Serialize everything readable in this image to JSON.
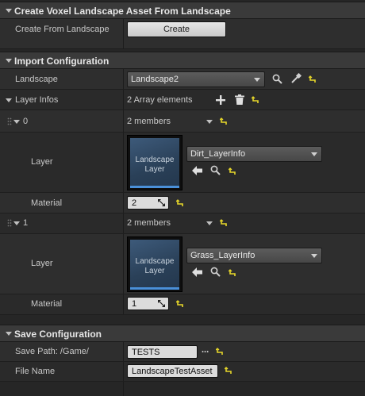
{
  "sections": {
    "create": {
      "title": "Create Voxel Landscape Asset From Landscape"
    },
    "import": {
      "title": "Import Configuration"
    },
    "save": {
      "title": "Save Configuration"
    }
  },
  "create_row": {
    "label": "Create From Landscape",
    "button_label": "Create"
  },
  "landscape_row": {
    "label": "Landscape",
    "value": "Landscape2"
  },
  "layer_infos": {
    "label": "Layer Infos",
    "count_text": "2 Array elements"
  },
  "elements": [
    {
      "index": "0",
      "members_text": "2 members",
      "layer_label": "Layer",
      "thumbnail_text": "Landscape Layer",
      "layer_value": "Dirt_LayerInfo",
      "material_label": "Material",
      "material_value": "2"
    },
    {
      "index": "1",
      "members_text": "2 members",
      "layer_label": "Layer",
      "thumbnail_text": "Landscape Layer",
      "layer_value": "Grass_LayerInfo",
      "material_label": "Material",
      "material_value": "1"
    }
  ],
  "save_path": {
    "label": "Save Path: /Game/",
    "value": "TESTS",
    "browse_label": "..."
  },
  "file_name": {
    "label": "File Name",
    "value": "LandscapeTestAsset"
  },
  "colors": {
    "reset_arrow": "#e8d82a",
    "thumb_bar": "#4a90d9"
  }
}
